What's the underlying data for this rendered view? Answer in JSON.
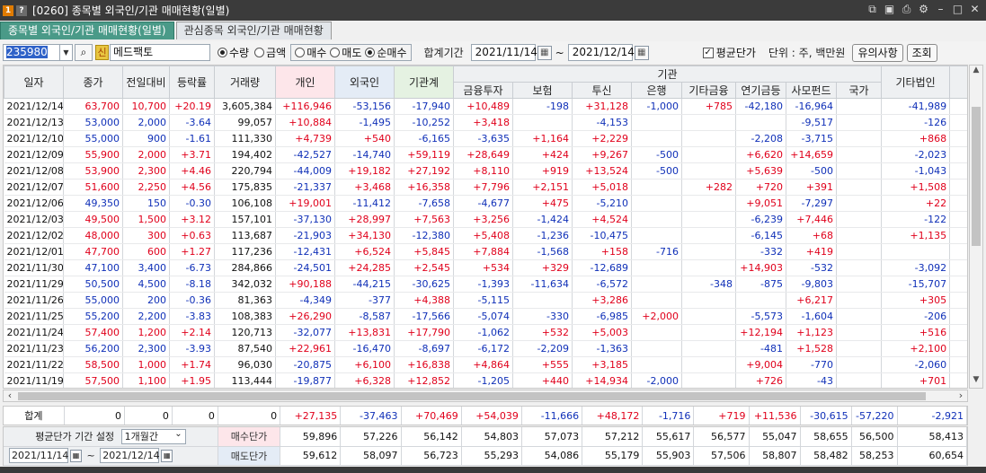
{
  "window": {
    "badge_num": "1",
    "badge_help": "?",
    "title": "[0260] 종목별 외국인/기관 매매현황(일별)"
  },
  "tabs": [
    "종목별 외국인/기관 매매현황(일별)",
    "관심종목 외국인/기관 매매현황"
  ],
  "toolbar": {
    "code": "235980",
    "shin": "신",
    "stock_name": "메드팩토",
    "radio1": [
      "수량",
      "금액"
    ],
    "radio2": [
      "매수",
      "매도",
      "순매수"
    ],
    "period_label": "합계기간",
    "date_from": "2021/11/14",
    "tilde": "~",
    "date_to": "2021/12/14",
    "avg_label": "평균단가",
    "unit_label": "단위 : 주, 백만원",
    "notes_btn": "유의사항",
    "query_btn": "조회"
  },
  "headers": {
    "date": "일자",
    "close": "종가",
    "change": "전일대비",
    "rate": "등락률",
    "volume": "거래량",
    "individual": "개인",
    "foreign": "외국인",
    "inst_total": "기관계",
    "inst_group": "기관",
    "inst_sub": [
      "금융투자",
      "보험",
      "투신",
      "은행",
      "기타금융",
      "연기금등",
      "사모펀드",
      "국가"
    ],
    "other_corp": "기타법인",
    "more": "기"
  },
  "rows": [
    {
      "date": "2021/12/14",
      "close": "63,700",
      "change": "10,700",
      "rate": "+20.19",
      "vol": "3,605,384",
      "ind": "+116,946",
      "for": "-53,156",
      "inst": "-17,940",
      "fin": "+10,489",
      "ins": "-198",
      "trust": "+31,128",
      "bank": "-1,000",
      "etc": "+785",
      "pen": "-42,180",
      "pef": "-16,964",
      "gov": "",
      "oth": "-41,989",
      "up": 1
    },
    {
      "date": "2021/12/13",
      "close": "53,000",
      "change": "2,000",
      "rate": "-3.64",
      "vol": "99,057",
      "ind": "+10,884",
      "for": "-1,495",
      "inst": "-10,252",
      "fin": "+3,418",
      "ins": "",
      "trust": "-4,153",
      "bank": "",
      "etc": "",
      "pen": "",
      "pef": "-9,517",
      "gov": "",
      "oth": "-126",
      "up": 0
    },
    {
      "date": "2021/12/10",
      "close": "55,000",
      "change": "900",
      "rate": "-1.61",
      "vol": "111,330",
      "ind": "+4,739",
      "for": "+540",
      "inst": "-6,165",
      "fin": "-3,635",
      "ins": "+1,164",
      "trust": "+2,229",
      "bank": "",
      "etc": "",
      "pen": "-2,208",
      "pef": "-3,715",
      "gov": "",
      "oth": "+868",
      "up": 0
    },
    {
      "date": "2021/12/09",
      "close": "55,900",
      "change": "2,000",
      "rate": "+3.71",
      "vol": "194,402",
      "ind": "-42,527",
      "for": "-14,740",
      "inst": "+59,119",
      "fin": "+28,649",
      "ins": "+424",
      "trust": "+9,267",
      "bank": "-500",
      "etc": "",
      "pen": "+6,620",
      "pef": "+14,659",
      "gov": "",
      "oth": "-2,023",
      "up": 1
    },
    {
      "date": "2021/12/08",
      "close": "53,900",
      "change": "2,300",
      "rate": "+4.46",
      "vol": "220,794",
      "ind": "-44,009",
      "for": "+19,182",
      "inst": "+27,192",
      "fin": "+8,110",
      "ins": "+919",
      "trust": "+13,524",
      "bank": "-500",
      "etc": "",
      "pen": "+5,639",
      "pef": "-500",
      "gov": "",
      "oth": "-1,043",
      "up": 1
    },
    {
      "date": "2021/12/07",
      "close": "51,600",
      "change": "2,250",
      "rate": "+4.56",
      "vol": "175,835",
      "ind": "-21,337",
      "for": "+3,468",
      "inst": "+16,358",
      "fin": "+7,796",
      "ins": "+2,151",
      "trust": "+5,018",
      "bank": "",
      "etc": "+282",
      "pen": "+720",
      "pef": "+391",
      "gov": "",
      "oth": "+1,508",
      "up": 1
    },
    {
      "date": "2021/12/06",
      "close": "49,350",
      "change": "150",
      "rate": "-0.30",
      "vol": "106,108",
      "ind": "+19,001",
      "for": "-11,412",
      "inst": "-7,658",
      "fin": "-4,677",
      "ins": "+475",
      "trust": "-5,210",
      "bank": "",
      "etc": "",
      "pen": "+9,051",
      "pef": "-7,297",
      "gov": "",
      "oth": "+22",
      "up": 0
    },
    {
      "date": "2021/12/03",
      "close": "49,500",
      "change": "1,500",
      "rate": "+3.12",
      "vol": "157,101",
      "ind": "-37,130",
      "for": "+28,997",
      "inst": "+7,563",
      "fin": "+3,256",
      "ins": "-1,424",
      "trust": "+4,524",
      "bank": "",
      "etc": "",
      "pen": "-6,239",
      "pef": "+7,446",
      "gov": "",
      "oth": "-122",
      "up": 1
    },
    {
      "date": "2021/12/02",
      "close": "48,000",
      "change": "300",
      "rate": "+0.63",
      "vol": "113,687",
      "ind": "-21,903",
      "for": "+34,130",
      "inst": "-12,380",
      "fin": "+5,408",
      "ins": "-1,236",
      "trust": "-10,475",
      "bank": "",
      "etc": "",
      "pen": "-6,145",
      "pef": "+68",
      "gov": "",
      "oth": "+1,135",
      "up": 1
    },
    {
      "date": "2021/12/01",
      "close": "47,700",
      "change": "600",
      "rate": "+1.27",
      "vol": "117,236",
      "ind": "-12,431",
      "for": "+6,524",
      "inst": "+5,845",
      "fin": "+7,884",
      "ins": "-1,568",
      "trust": "+158",
      "bank": "-716",
      "etc": "",
      "pen": "-332",
      "pef": "+419",
      "gov": "",
      "oth": "",
      "up": 1
    },
    {
      "date": "2021/11/30",
      "close": "47,100",
      "change": "3,400",
      "rate": "-6.73",
      "vol": "284,866",
      "ind": "-24,501",
      "for": "+24,285",
      "inst": "+2,545",
      "fin": "+534",
      "ins": "+329",
      "trust": "-12,689",
      "bank": "",
      "etc": "",
      "pen": "+14,903",
      "pef": "-532",
      "gov": "",
      "oth": "-3,092",
      "up": 0
    },
    {
      "date": "2021/11/29",
      "close": "50,500",
      "change": "4,500",
      "rate": "-8.18",
      "vol": "342,032",
      "ind": "+90,188",
      "for": "-44,215",
      "inst": "-30,625",
      "fin": "-1,393",
      "ins": "-11,634",
      "trust": "-6,572",
      "bank": "",
      "etc": "-348",
      "pen": "-875",
      "pef": "-9,803",
      "gov": "",
      "oth": "-15,707",
      "up": 0
    },
    {
      "date": "2021/11/26",
      "close": "55,000",
      "change": "200",
      "rate": "-0.36",
      "vol": "81,363",
      "ind": "-4,349",
      "for": "-377",
      "inst": "+4,388",
      "fin": "-5,115",
      "ins": "",
      "trust": "+3,286",
      "bank": "",
      "etc": "",
      "pen": "",
      "pef": "+6,217",
      "gov": "",
      "oth": "+305",
      "up": 0
    },
    {
      "date": "2021/11/25",
      "close": "55,200",
      "change": "2,200",
      "rate": "-3.83",
      "vol": "108,383",
      "ind": "+26,290",
      "for": "-8,587",
      "inst": "-17,566",
      "fin": "-5,074",
      "ins": "-330",
      "trust": "-6,985",
      "bank": "+2,000",
      "etc": "",
      "pen": "-5,573",
      "pef": "-1,604",
      "gov": "",
      "oth": "-206",
      "up": 0
    },
    {
      "date": "2021/11/24",
      "close": "57,400",
      "change": "1,200",
      "rate": "+2.14",
      "vol": "120,713",
      "ind": "-32,077",
      "for": "+13,831",
      "inst": "+17,790",
      "fin": "-1,062",
      "ins": "+532",
      "trust": "+5,003",
      "bank": "",
      "etc": "",
      "pen": "+12,194",
      "pef": "+1,123",
      "gov": "",
      "oth": "+516",
      "up": 1
    },
    {
      "date": "2021/11/23",
      "close": "56,200",
      "change": "2,300",
      "rate": "-3.93",
      "vol": "87,540",
      "ind": "+22,961",
      "for": "-16,470",
      "inst": "-8,697",
      "fin": "-6,172",
      "ins": "-2,209",
      "trust": "-1,363",
      "bank": "",
      "etc": "",
      "pen": "-481",
      "pef": "+1,528",
      "gov": "",
      "oth": "+2,100",
      "up": 0
    },
    {
      "date": "2021/11/22",
      "close": "58,500",
      "change": "1,000",
      "rate": "+1.74",
      "vol": "96,030",
      "ind": "-20,875",
      "for": "+6,100",
      "inst": "+16,838",
      "fin": "+4,864",
      "ins": "+555",
      "trust": "+3,185",
      "bank": "",
      "etc": "",
      "pen": "+9,004",
      "pef": "-770",
      "gov": "",
      "oth": "-2,060",
      "up": 1
    },
    {
      "date": "2021/11/19",
      "close": "57,500",
      "change": "1,100",
      "rate": "+1.95",
      "vol": "113,444",
      "ind": "-19,877",
      "for": "+6,328",
      "inst": "+12,852",
      "fin": "-1,205",
      "ins": "+440",
      "trust": "+14,934",
      "bank": "-2,000",
      "etc": "",
      "pen": "+726",
      "pef": "-43",
      "gov": "",
      "oth": "+701",
      "up": 1
    }
  ],
  "totals": {
    "label": "합계",
    "close": "0",
    "change": "0",
    "rate": "0",
    "vol": "0",
    "ind": "+27,135",
    "for": "-37,463",
    "inst": "+70,469",
    "fin": "+54,039",
    "ins": "-11,666",
    "trust": "+48,172",
    "bank": "-1,716",
    "etc": "+719",
    "pen": "+11,536",
    "pef": "-30,615",
    "gov": "-57,220",
    "oth": "-2,921"
  },
  "avg": {
    "period_label": "평균단가 기간 설정",
    "period_value": "1개월간",
    "date_from": "2021/11/14",
    "tilde": "~",
    "date_to": "2021/12/14",
    "buy_label": "매수단가",
    "sell_label": "매도단가",
    "buy": [
      "59,896",
      "57,226",
      "56,142",
      "54,803",
      "57,073",
      "57,212",
      "55,617",
      "56,577",
      "55,047",
      "58,655",
      "56,500",
      "58,413"
    ],
    "sell": [
      "59,612",
      "58,097",
      "56,723",
      "55,293",
      "54,086",
      "55,179",
      "55,903",
      "57,506",
      "58,807",
      "58,482",
      "58,253",
      "60,654"
    ]
  },
  "colors": {
    "up": "#e0001b",
    "down": "#1030b8",
    "tab_active": "#4a9a88"
  }
}
